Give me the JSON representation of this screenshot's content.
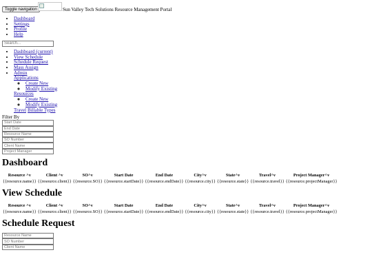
{
  "header": {
    "toggle_label": "Toggle navigation",
    "brand": "Sun Valley Tech Solutions Resource Management Portal"
  },
  "top_nav": [
    "Dashboard",
    "Settings",
    "Profile",
    "Help"
  ],
  "search": {
    "placeholder": "Search..."
  },
  "side_nav": {
    "dashboard": "Dashboard (current)",
    "view_schedule": "View Schedule",
    "schedule_request": "Schedule Request",
    "mass_assign": "Mass Assign",
    "admin": "Admin",
    "applications": "Applications",
    "app_create": "Create New",
    "app_modify": "Modify Existing",
    "resources": "Resources",
    "res_create": "Create New",
    "res_modify": "Modify Existing",
    "travel": "Travel",
    "billable": "Billable Types"
  },
  "filter": {
    "label": "Filter By",
    "fields": [
      "Start Date",
      "End Date",
      "Resource Name",
      "SO Number",
      "Client Name",
      "Project Manager"
    ]
  },
  "dashboard": {
    "title": "Dashboard",
    "headers": [
      "Resource ^v",
      "Client ^v",
      "SO^v",
      "Start Date",
      "End Date",
      "City^v",
      "State^v",
      "Travel^v",
      "Project Manager^v"
    ],
    "row": [
      "{{resource.name}}",
      "{{resource.client}}",
      "{{resource.SO}}",
      "{{resource.startDate}}",
      "{{resource.endDate}}",
      "{{resource.city}}",
      "{{resource.state}}",
      "{{resource.travel}}",
      "{{resource.projectManager}}"
    ]
  },
  "view_schedule": {
    "title": "View Schedule",
    "headers": [
      "Resource ^v",
      "Client ^v",
      "SO^v",
      "Start Date",
      "End Date",
      "City^v",
      "State^v",
      "Travel^v",
      "Project Manager^v"
    ],
    "row": [
      "{{resource.name}}",
      "{{resource.client}}",
      "{{resource.SO}}",
      "{{resource.startDate}}",
      "{{resource.endDate}}",
      "{{resource.city}}",
      "{{resource.state}}",
      "{{resource.travel}}",
      "{{resource.projectManager}}"
    ]
  },
  "schedule_request": {
    "title": "Schedule Request",
    "fields": [
      "Resource Name",
      "SO Number",
      "Client Name"
    ]
  }
}
